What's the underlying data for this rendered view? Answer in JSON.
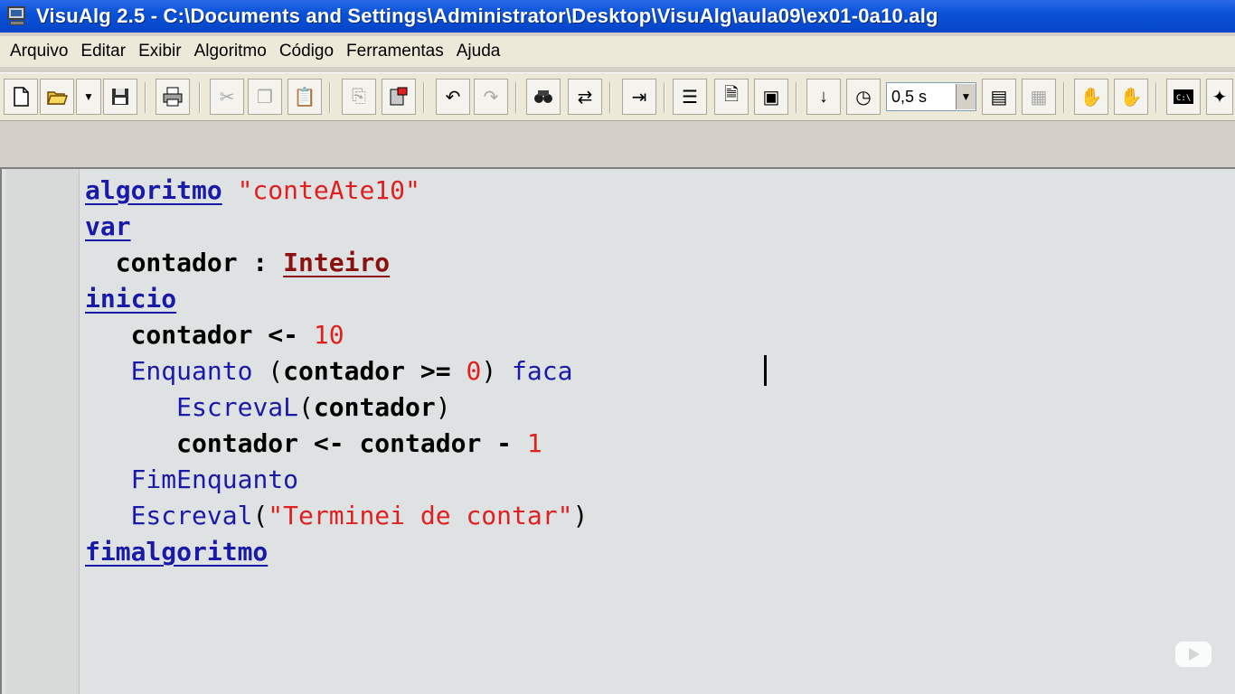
{
  "window": {
    "title": "VisuAlg 2.5 - C:\\Documents and Settings\\Administrator\\Desktop\\VisuAlg\\aula09\\ex01-0a10.alg"
  },
  "menu": [
    "Arquivo",
    "Editar",
    "Exibir",
    "Algoritmo",
    "Código",
    "Ferramentas",
    "Ajuda"
  ],
  "toolbar": {
    "speed": "0,5 s",
    "buttons": [
      {
        "name": "new-file-icon"
      },
      {
        "name": "open-folder-icon"
      },
      {
        "name": "dropdown-arrow-icon"
      },
      {
        "name": "save-icon"
      },
      {
        "name": "print-icon"
      },
      {
        "name": "cut-icon"
      },
      {
        "name": "copy-icon"
      },
      {
        "name": "paste-icon"
      },
      {
        "name": "copy-document-icon"
      },
      {
        "name": "paste-document-icon"
      },
      {
        "name": "undo-icon"
      },
      {
        "name": "redo-icon"
      },
      {
        "name": "find-icon"
      },
      {
        "name": "replace-icon"
      },
      {
        "name": "indent-icon"
      },
      {
        "name": "numbered-list-icon"
      },
      {
        "name": "document-icon"
      },
      {
        "name": "form-icon"
      },
      {
        "name": "step-icon"
      },
      {
        "name": "timer-icon"
      },
      {
        "name": "variables-icon"
      },
      {
        "name": "breakpoint-icon"
      },
      {
        "name": "hand-icon"
      },
      {
        "name": "stop-hand-icon"
      },
      {
        "name": "console-icon"
      },
      {
        "name": "magic-wand-icon"
      }
    ]
  },
  "code": {
    "l1_kw": "algoritmo",
    "l1_str": "\"conteAte10\"",
    "l2_kw": "var",
    "l3_ident": "contador",
    "l3_colon": " : ",
    "l3_type": "Inteiro",
    "l4_kw": "inicio",
    "l5_ident": "contador <-",
    "l5_num": "10",
    "l6_fn": "Enquanto",
    "l6_paren_open": " (",
    "l6_ident": "contador >=",
    "l6_num": "0",
    "l6_close": ")",
    "l6_fn2": "faca",
    "l7_fn": "EscrevaL",
    "l7_open": "(",
    "l7_ident": "contador",
    "l7_close": ")",
    "l8_ident": "contador <- contador -",
    "l8_num": "1",
    "l9_fn": "FimEnquanto",
    "l10_fn": "Escreval",
    "l10_open": "(",
    "l10_str": "\"Terminei de contar\"",
    "l10_close": ")",
    "l11_kw": "fimalgoritmo"
  },
  "colors": {
    "keyword": "#1a1aa8",
    "type": "#8b1010",
    "string": "#e02020",
    "titlebar": "#0a52d8"
  }
}
